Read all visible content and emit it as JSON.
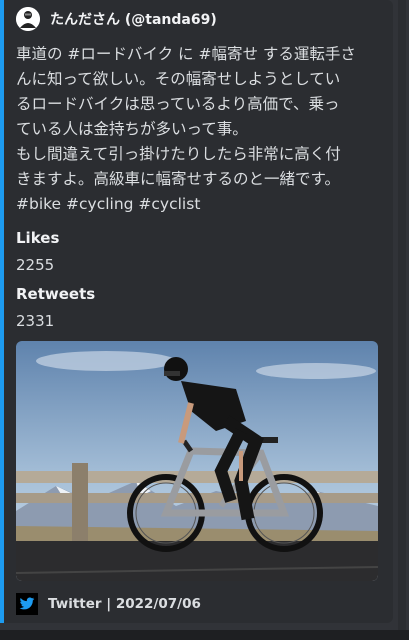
{
  "author": {
    "display": "たんださん (@tanda69)",
    "avatar_icon": "rider-avatar"
  },
  "description_lines": [
    "車道の #ロードバイク に #幅寄せ する運転手さ",
    "んに知って欲しい。その幅寄せしようとしてい",
    "るロードバイクは思っているより高価で、乗っ",
    "ている人は金持ちが多いって事。",
    "もし間違えて引っ掛けたりしたら非常に高く付",
    "きますよ。高級車に幅寄せするのと一緒です。",
    "#bike #cycling #cyclist"
  ],
  "fields": [
    {
      "name": "Likes",
      "value": "2255"
    },
    {
      "name": "Retweets",
      "value": "2331"
    }
  ],
  "image": {
    "icon": "cyclist-photo"
  },
  "footer": {
    "text": "Twitter | 2022/07/06",
    "icon": "twitter-bird-icon"
  },
  "colors": {
    "accent_bar": "#1d9bf0",
    "embed_bg": "#2b2d31",
    "twitter_blue": "#1d9bf0"
  }
}
